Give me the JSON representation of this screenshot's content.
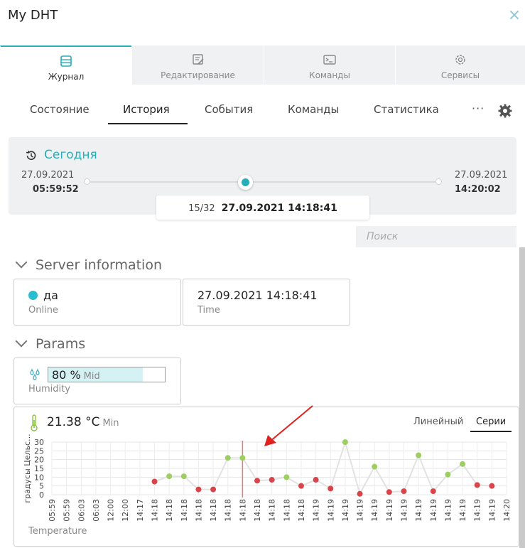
{
  "window": {
    "title": "My DHT",
    "close_label": "×"
  },
  "top_tabs": [
    {
      "label": "Журнал",
      "icon": "journal-icon",
      "active": true
    },
    {
      "label": "Редактирование",
      "icon": "edit-icon",
      "active": false
    },
    {
      "label": "Команды",
      "icon": "terminal-icon",
      "active": false
    },
    {
      "label": "Сервисы",
      "icon": "services-gear-icon",
      "active": false
    }
  ],
  "sub_tabs": [
    {
      "label": "Состояние",
      "active": false
    },
    {
      "label": "История",
      "active": true
    },
    {
      "label": "События",
      "active": false
    },
    {
      "label": "Команды",
      "active": false
    },
    {
      "label": "Статистика",
      "active": false
    }
  ],
  "more_label": "···",
  "timeline": {
    "today_label": "Сегодня",
    "start_date": "27.09.2021",
    "start_time": "05:59:52",
    "end_date": "27.09.2021",
    "end_time": "14:20:02",
    "position_count": "15/32",
    "position_datetime": "27.09.2021 14:18:41",
    "slider_fraction": 0.45
  },
  "search": {
    "placeholder": "Поиск",
    "value": ""
  },
  "server_info": {
    "heading": "Server information",
    "online": {
      "value": "да",
      "caption": "Online",
      "color": "#27bfd0"
    },
    "time": {
      "value": "27.09.2021 14:18:41",
      "caption": "Time"
    }
  },
  "params": {
    "heading": "Params",
    "humidity": {
      "value": "80 %",
      "level": "Mid",
      "caption": "Humidity",
      "fill_fraction": 0.8
    },
    "temperature": {
      "value": "21.38 °C",
      "level": "Min",
      "caption": "Temperature",
      "mode_linear": "Линейный",
      "mode_series": "Серии"
    }
  },
  "chart_data": {
    "type": "line",
    "ylabel": "градусы Цельс...",
    "ylim": [
      0,
      30
    ],
    "y_ticks": [
      "30",
      "25",
      "20",
      "15",
      "10",
      "5",
      "0"
    ],
    "x_tick_labels": [
      "05:59",
      "05:59",
      "06:03",
      "06:03",
      "12:00",
      "12:00",
      "14:17",
      "14:18",
      "14:18",
      "14:18",
      "14:18",
      "14:18",
      "14:18",
      "14:18",
      "14:18",
      "14:18",
      "14:18",
      "14:18",
      "14:19",
      "14:19",
      "14:19",
      "14:19",
      "14:19",
      "14:19",
      "14:19",
      "14:19",
      "14:19",
      "14:19",
      "14:19",
      "14:19",
      "14:19",
      "14:20"
    ],
    "series": [
      {
        "values": [
          null,
          null,
          null,
          null,
          null,
          null,
          null,
          7.5,
          10.5,
          10.5,
          3,
          3,
          21,
          21,
          8,
          8.5,
          10,
          5,
          8.5,
          3.5,
          30,
          0.5,
          16,
          1.5,
          2,
          22.5,
          2,
          11.5,
          17.5,
          5.5,
          5
        ]
      }
    ],
    "point_colors": {
      "high": "#9ccf5f",
      "low": "#d9444b"
    },
    "line_color": "#e2e2e2",
    "cursor_index": 13,
    "cursor_color": "#e27b7b",
    "grid": true
  }
}
